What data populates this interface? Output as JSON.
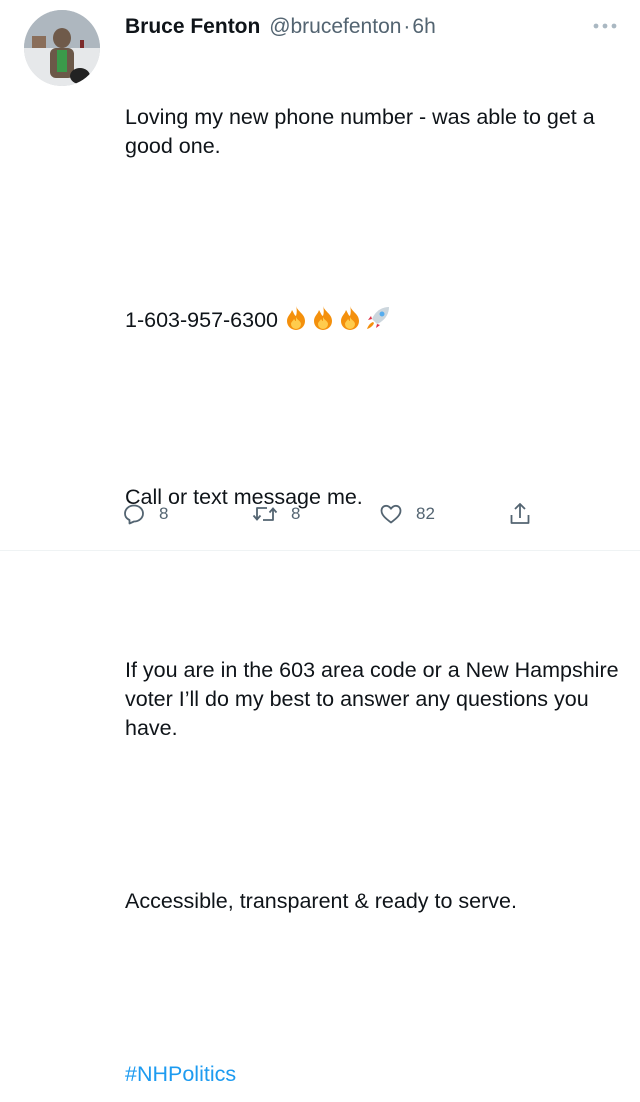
{
  "tweet": {
    "author_name": "Bruce Fenton",
    "author_handle": "@brucefenton",
    "separator": "·",
    "time": "6h",
    "paragraphs": [
      "Loving my new phone number - was able to get a good one.",
      "1-603-957-6300",
      "Call or text message me.",
      "If you are in the 603 area code or a New Hampshire voter I’ll do my best to answer any questions you have.",
      "Accessible, transparent & ready to serve."
    ],
    "hashtag": "#NHPolitics",
    "emojis": [
      "fire-icon",
      "fire-icon",
      "fire-icon",
      "rocket-icon"
    ]
  },
  "actions": {
    "reply_count": "8",
    "retweet_count": "8",
    "like_count": "82"
  },
  "colors": {
    "link": "#1d9bf0",
    "secondary_text": "#536471",
    "primary_text": "#0f1419"
  }
}
